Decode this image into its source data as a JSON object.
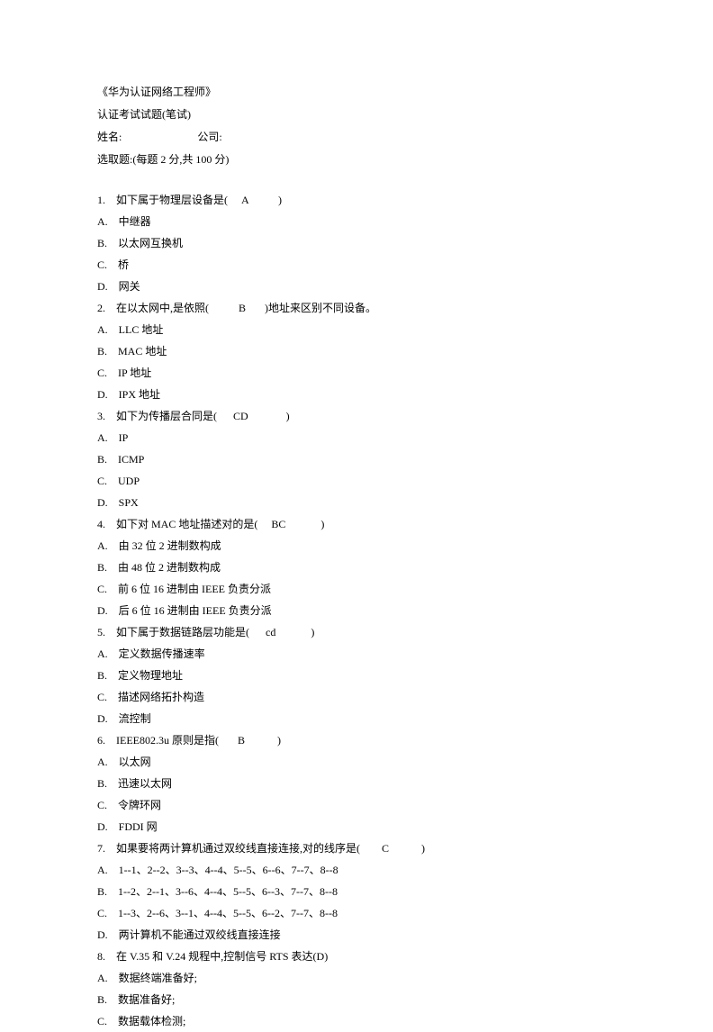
{
  "header": {
    "title": "《华为认证网络工程师》",
    "subtitle": "认证考试试题(笔试)",
    "name_label": "姓名:",
    "company_label": "公司:",
    "instructions": "选取题:(每题 2 分,共 100 分)"
  },
  "questions": [
    {
      "num": "1.",
      "text": "如下属于物理层设备是(     A           )",
      "options": [
        {
          "letter": "A.",
          "text": "中继器"
        },
        {
          "letter": "B.",
          "text": "以太网互换机"
        },
        {
          "letter": "C.",
          "text": "桥"
        },
        {
          "letter": "D.",
          "text": "网关"
        }
      ]
    },
    {
      "num": "2.",
      "text": "在以太网中,是依照(           B       )地址来区别不同设备。",
      "options": [
        {
          "letter": "A.",
          "text": "LLC 地址"
        },
        {
          "letter": "B.",
          "text": "MAC 地址"
        },
        {
          "letter": "C.",
          "text": "IP 地址"
        },
        {
          "letter": "D.",
          "text": "IPX 地址"
        }
      ]
    },
    {
      "num": "3.",
      "text": "如下为传播层合同是(      CD              )",
      "options": [
        {
          "letter": "A.",
          "text": "IP"
        },
        {
          "letter": "B.",
          "text": "ICMP"
        },
        {
          "letter": "C.",
          "text": "UDP"
        },
        {
          "letter": "D.",
          "text": "SPX"
        }
      ]
    },
    {
      "num": "4.",
      "text": "如下对 MAC 地址描述对的是(     BC             )",
      "options": [
        {
          "letter": "A.",
          "text": "由 32 位 2 进制数构成"
        },
        {
          "letter": "B.",
          "text": "由 48 位 2 进制数构成"
        },
        {
          "letter": "C.",
          "text": "前 6 位 16 进制由 IEEE 负责分派"
        },
        {
          "letter": "D.",
          "text": "后 6 位 16 进制由 IEEE 负责分派"
        }
      ]
    },
    {
      "num": "5.",
      "text": "如下属于数据链路层功能是(      cd             )",
      "options": [
        {
          "letter": "A.",
          "text": "定义数据传播速率"
        },
        {
          "letter": "B.",
          "text": "定义物理地址"
        },
        {
          "letter": "C.",
          "text": "描述网络拓扑构造"
        },
        {
          "letter": "D.",
          "text": "流控制"
        }
      ]
    },
    {
      "num": "6.",
      "text": "IEEE802.3u 原则是指(       B            )",
      "options": [
        {
          "letter": "A.",
          "text": "以太网"
        },
        {
          "letter": "B.",
          "text": "迅速以太网"
        },
        {
          "letter": "C.",
          "text": "令牌环网"
        },
        {
          "letter": "D.",
          "text": "FDDI 网"
        }
      ]
    },
    {
      "num": "7.",
      "text": "如果要将两计算机通过双绞线直接连接,对的线序是(        C            )",
      "options": [
        {
          "letter": "A.",
          "text": "1--1、2--2、3--3、4--4、5--5、6--6、7--7、8--8"
        },
        {
          "letter": "B.",
          "text": "1--2、2--1、3--6、4--4、5--5、6--3、7--7、8--8"
        },
        {
          "letter": "C.",
          "text": "1--3、2--6、3--1、4--4、5--5、6--2、7--7、8--8"
        },
        {
          "letter": "D.",
          "text": "两计算机不能通过双绞线直接连接"
        }
      ]
    },
    {
      "num": "8.",
      "text": "在 V.35 和 V.24 规程中,控制信号 RTS 表达(D)",
      "options": [
        {
          "letter": "A.",
          "text": "数据终端准备好;"
        },
        {
          "letter": "B.",
          "text": "数据准备好;"
        },
        {
          "letter": "C.",
          "text": "数据载体检测;"
        }
      ]
    }
  ]
}
